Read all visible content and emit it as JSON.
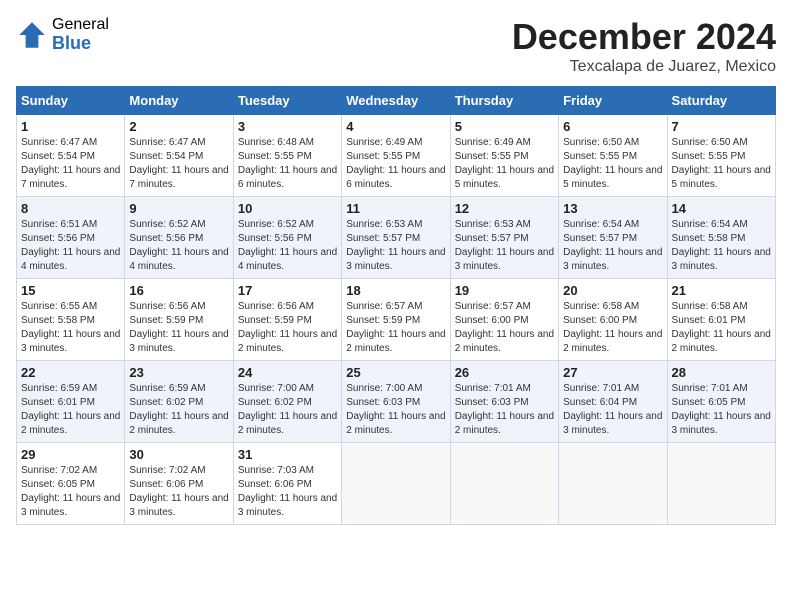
{
  "logo": {
    "general": "General",
    "blue": "Blue"
  },
  "header": {
    "month": "December 2024",
    "location": "Texcalapa de Juarez, Mexico"
  },
  "weekdays": [
    "Sunday",
    "Monday",
    "Tuesday",
    "Wednesday",
    "Thursday",
    "Friday",
    "Saturday"
  ],
  "weeks": [
    [
      {
        "day": "1",
        "sunrise": "6:47 AM",
        "sunset": "5:54 PM",
        "daylight": "11 hours and 7 minutes."
      },
      {
        "day": "2",
        "sunrise": "6:47 AM",
        "sunset": "5:54 PM",
        "daylight": "11 hours and 7 minutes."
      },
      {
        "day": "3",
        "sunrise": "6:48 AM",
        "sunset": "5:55 PM",
        "daylight": "11 hours and 6 minutes."
      },
      {
        "day": "4",
        "sunrise": "6:49 AM",
        "sunset": "5:55 PM",
        "daylight": "11 hours and 6 minutes."
      },
      {
        "day": "5",
        "sunrise": "6:49 AM",
        "sunset": "5:55 PM",
        "daylight": "11 hours and 5 minutes."
      },
      {
        "day": "6",
        "sunrise": "6:50 AM",
        "sunset": "5:55 PM",
        "daylight": "11 hours and 5 minutes."
      },
      {
        "day": "7",
        "sunrise": "6:50 AM",
        "sunset": "5:55 PM",
        "daylight": "11 hours and 5 minutes."
      }
    ],
    [
      {
        "day": "8",
        "sunrise": "6:51 AM",
        "sunset": "5:56 PM",
        "daylight": "11 hours and 4 minutes."
      },
      {
        "day": "9",
        "sunrise": "6:52 AM",
        "sunset": "5:56 PM",
        "daylight": "11 hours and 4 minutes."
      },
      {
        "day": "10",
        "sunrise": "6:52 AM",
        "sunset": "5:56 PM",
        "daylight": "11 hours and 4 minutes."
      },
      {
        "day": "11",
        "sunrise": "6:53 AM",
        "sunset": "5:57 PM",
        "daylight": "11 hours and 3 minutes."
      },
      {
        "day": "12",
        "sunrise": "6:53 AM",
        "sunset": "5:57 PM",
        "daylight": "11 hours and 3 minutes."
      },
      {
        "day": "13",
        "sunrise": "6:54 AM",
        "sunset": "5:57 PM",
        "daylight": "11 hours and 3 minutes."
      },
      {
        "day": "14",
        "sunrise": "6:54 AM",
        "sunset": "5:58 PM",
        "daylight": "11 hours and 3 minutes."
      }
    ],
    [
      {
        "day": "15",
        "sunrise": "6:55 AM",
        "sunset": "5:58 PM",
        "daylight": "11 hours and 3 minutes."
      },
      {
        "day": "16",
        "sunrise": "6:56 AM",
        "sunset": "5:59 PM",
        "daylight": "11 hours and 3 minutes."
      },
      {
        "day": "17",
        "sunrise": "6:56 AM",
        "sunset": "5:59 PM",
        "daylight": "11 hours and 2 minutes."
      },
      {
        "day": "18",
        "sunrise": "6:57 AM",
        "sunset": "5:59 PM",
        "daylight": "11 hours and 2 minutes."
      },
      {
        "day": "19",
        "sunrise": "6:57 AM",
        "sunset": "6:00 PM",
        "daylight": "11 hours and 2 minutes."
      },
      {
        "day": "20",
        "sunrise": "6:58 AM",
        "sunset": "6:00 PM",
        "daylight": "11 hours and 2 minutes."
      },
      {
        "day": "21",
        "sunrise": "6:58 AM",
        "sunset": "6:01 PM",
        "daylight": "11 hours and 2 minutes."
      }
    ],
    [
      {
        "day": "22",
        "sunrise": "6:59 AM",
        "sunset": "6:01 PM",
        "daylight": "11 hours and 2 minutes."
      },
      {
        "day": "23",
        "sunrise": "6:59 AM",
        "sunset": "6:02 PM",
        "daylight": "11 hours and 2 minutes."
      },
      {
        "day": "24",
        "sunrise": "7:00 AM",
        "sunset": "6:02 PM",
        "daylight": "11 hours and 2 minutes."
      },
      {
        "day": "25",
        "sunrise": "7:00 AM",
        "sunset": "6:03 PM",
        "daylight": "11 hours and 2 minutes."
      },
      {
        "day": "26",
        "sunrise": "7:01 AM",
        "sunset": "6:03 PM",
        "daylight": "11 hours and 2 minutes."
      },
      {
        "day": "27",
        "sunrise": "7:01 AM",
        "sunset": "6:04 PM",
        "daylight": "11 hours and 3 minutes."
      },
      {
        "day": "28",
        "sunrise": "7:01 AM",
        "sunset": "6:05 PM",
        "daylight": "11 hours and 3 minutes."
      }
    ],
    [
      {
        "day": "29",
        "sunrise": "7:02 AM",
        "sunset": "6:05 PM",
        "daylight": "11 hours and 3 minutes."
      },
      {
        "day": "30",
        "sunrise": "7:02 AM",
        "sunset": "6:06 PM",
        "daylight": "11 hours and 3 minutes."
      },
      {
        "day": "31",
        "sunrise": "7:03 AM",
        "sunset": "6:06 PM",
        "daylight": "11 hours and 3 minutes."
      },
      null,
      null,
      null,
      null
    ]
  ]
}
